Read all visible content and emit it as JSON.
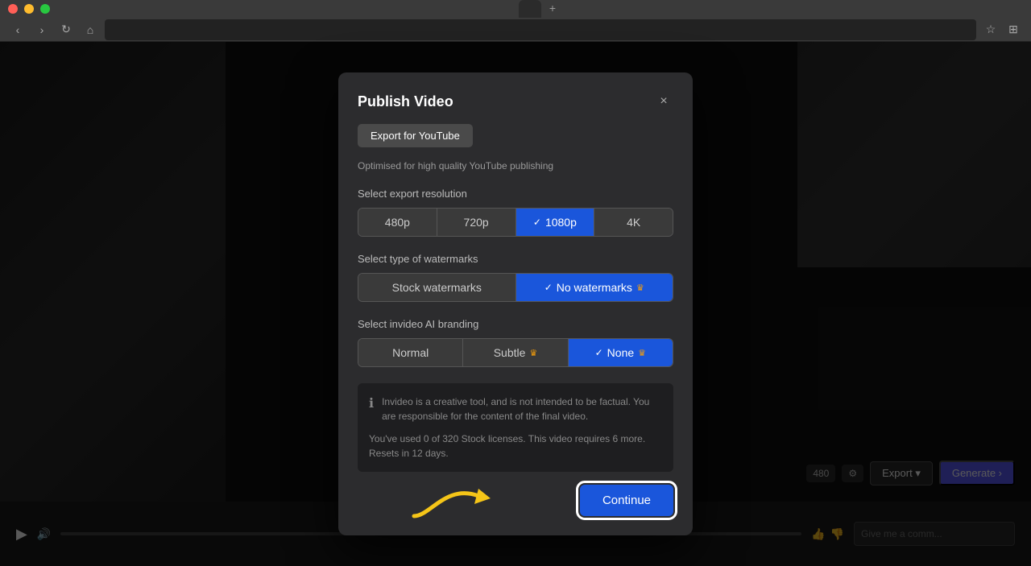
{
  "browser": {
    "tab_title": "",
    "address": "",
    "nav": {
      "back": "‹",
      "forward": "›",
      "reload": "↻",
      "home": "⌂"
    }
  },
  "modal": {
    "title": "Publish Video",
    "close_icon": "×",
    "export_tab_label": "Export for YouTube",
    "subtitle": "Optimised for high quality YouTube publishing",
    "resolution_section_label": "Select export resolution",
    "resolution_options": [
      {
        "label": "480p",
        "active": false
      },
      {
        "label": "720p",
        "active": false
      },
      {
        "label": "1080p",
        "active": true
      },
      {
        "label": "4K",
        "active": false
      }
    ],
    "watermark_section_label": "Select type of watermarks",
    "watermark_options": [
      {
        "label": "Stock watermarks",
        "active": false
      },
      {
        "label": "No watermarks",
        "active": true,
        "premium": true
      }
    ],
    "branding_section_label": "Select invideo AI branding",
    "branding_options": [
      {
        "label": "Normal",
        "active": false
      },
      {
        "label": "Subtle",
        "active": false,
        "premium": true
      },
      {
        "label": "None",
        "active": true,
        "premium": true
      }
    ],
    "info_text_1": "Invideo is a creative tool, and is not intended to be factual. You are responsible for the content of the final video.",
    "info_text_2": "You've used 0 of 320 Stock licenses. This video requires 6 more. Resets in 12 days.",
    "continue_label": "Continue"
  },
  "controls": {
    "play_icon": "▶",
    "volume_icon": "🔊",
    "comment_placeholder": "Give me a comm...",
    "export_label": "Export",
    "generate_label": "Generate ›"
  },
  "icons": {
    "check": "✓",
    "crown": "♛",
    "info": "ℹ",
    "close": "×",
    "star": "★"
  },
  "colors": {
    "active_blue": "#1a56db",
    "premium_gold": "#f59e0b",
    "continue_bg": "#1a56db"
  }
}
